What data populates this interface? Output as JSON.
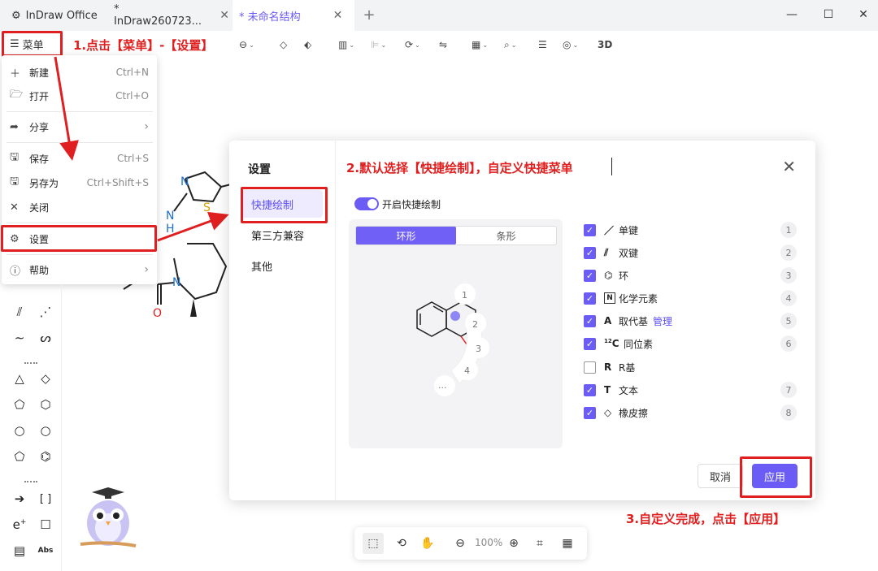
{
  "tabs": [
    {
      "label": "InDraw Office",
      "icon": "app-icon"
    },
    {
      "label": "* InDraw260723...",
      "icon": ""
    },
    {
      "label": "* 未命名结构",
      "icon": ""
    }
  ],
  "toolbar": {
    "menu_label": "菜单",
    "label_3d": "3D"
  },
  "menu": {
    "items": [
      {
        "label": "新建",
        "shortcut": "Ctrl+N",
        "icon": "plus-icon"
      },
      {
        "label": "打开",
        "shortcut": "Ctrl+O",
        "icon": "folder-icon"
      },
      {
        "label": "分享",
        "shortcut": "›",
        "icon": "share-icon"
      },
      {
        "label": "保存",
        "shortcut": "Ctrl+S",
        "icon": "save-icon"
      },
      {
        "label": "另存为",
        "shortcut": "Ctrl+Shift+S",
        "icon": "save-as-icon"
      },
      {
        "label": "关闭",
        "shortcut": "",
        "icon": "close-icon"
      },
      {
        "label": "设置",
        "shortcut": "",
        "icon": "gear-icon"
      },
      {
        "label": "帮助",
        "shortcut": "›",
        "icon": "info-icon"
      }
    ]
  },
  "annotations": {
    "step1": "1.点击【菜单】-【设置】",
    "step2": "2.默认选择【快捷绘制】，自定义快捷菜单",
    "step3": "3.自定义完成，点击【应用】"
  },
  "dialog": {
    "title": "设置",
    "nav": [
      "快捷绘制",
      "第三方兼容",
      "其他"
    ],
    "toggle_label": "开启快捷绘制",
    "toggle_on": true,
    "segments": [
      "环形",
      "条形"
    ],
    "active_segment": "环形",
    "preview_numbers": [
      "1",
      "2",
      "3",
      "4",
      "..."
    ],
    "options": [
      {
        "label": "单键",
        "icon": "single-bond-icon",
        "checked": true,
        "num": "1"
      },
      {
        "label": "双键",
        "icon": "double-bond-icon",
        "checked": true,
        "num": "2"
      },
      {
        "label": "环",
        "icon": "ring-icon",
        "checked": true,
        "num": "3"
      },
      {
        "label": "化学元素",
        "icon": "element-icon",
        "checked": true,
        "num": "4"
      },
      {
        "label": "取代基",
        "icon": "substituent-icon",
        "checked": true,
        "num": "5",
        "extra": "管理"
      },
      {
        "label": "同位素",
        "icon": "isotope-icon",
        "checked": true,
        "num": "6"
      },
      {
        "label": "R基",
        "icon": "r-group-icon",
        "checked": false,
        "num": ""
      },
      {
        "label": "文本",
        "icon": "text-icon",
        "checked": true,
        "num": "7"
      },
      {
        "label": "橡皮擦",
        "icon": "eraser-icon",
        "checked": true,
        "num": "8"
      }
    ],
    "cancel_label": "取消",
    "apply_label": "应用"
  },
  "molecule_labels": {
    "n1": "N",
    "s1": "S",
    "nh": "N",
    "h": "H",
    "n2": "N",
    "o": "O"
  },
  "bottombar": {
    "zoom": "100%"
  },
  "toolbox": {
    "abs_label": "Abs",
    "e_label": "e",
    "e_sup": "+",
    "bracket_label": "[ ]"
  },
  "colors": {
    "accent": "#6b5cf6",
    "annotation": "#e02020"
  }
}
